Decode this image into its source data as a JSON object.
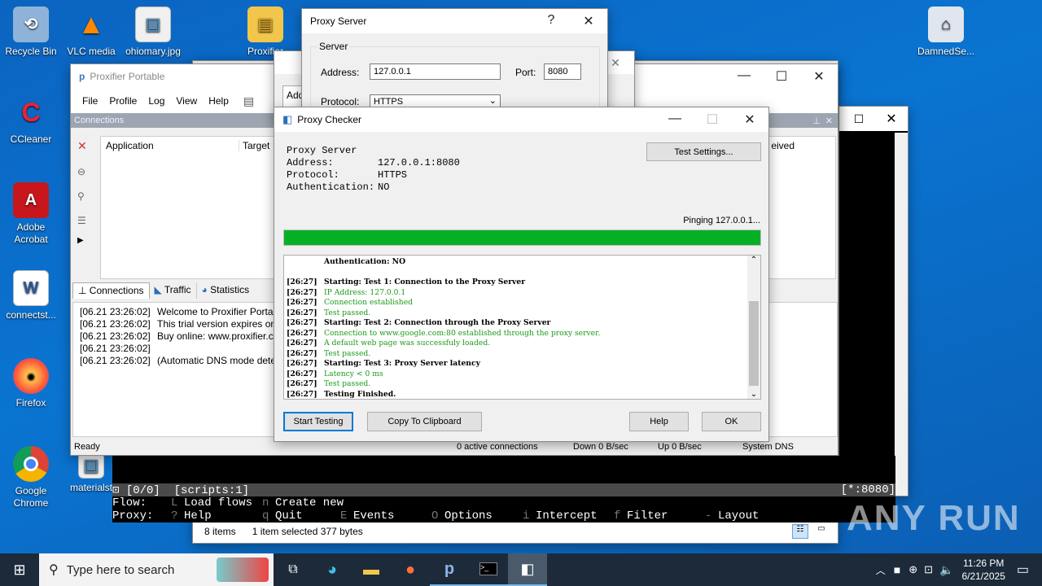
{
  "desktop": {
    "icons": [
      {
        "label": "Recycle Bin",
        "glyph": "🗑",
        "color": "#9ab"
      },
      {
        "label": "VLC media",
        "glyph": "▲",
        "color": "#f80"
      },
      {
        "label": "ohiomary.jpg",
        "glyph": "▣",
        "color": "#dde"
      },
      {
        "label": "Proxifier",
        "glyph": "▤",
        "color": "#eb3"
      },
      {
        "label": "DamnedSe...",
        "glyph": "⌂",
        "color": "#ccd"
      },
      {
        "label": "CCleaner",
        "glyph": "C",
        "color": "#d33"
      },
      {
        "label": "Adobe Acrobat",
        "glyph": "A",
        "color": "#c00"
      },
      {
        "label": "connectst...",
        "glyph": "W",
        "color": "#2b5"
      },
      {
        "label": "Firefox",
        "glyph": "●",
        "color": "#f60"
      },
      {
        "label": "Google Chrome",
        "glyph": "◉",
        "color": "#4a4"
      },
      {
        "label": "materialst",
        "glyph": "▣",
        "color": "#ddd"
      }
    ]
  },
  "proxifier": {
    "title": "Proxifier Portable",
    "menu": [
      "File",
      "Profile",
      "Log",
      "View",
      "Help"
    ],
    "connections_label": "Connections",
    "col_application": "Application",
    "col_target": "Target",
    "col_received": "eived",
    "tabs": [
      "Connections",
      "Traffic",
      "Statistics"
    ],
    "log": [
      {
        "time": "[06.21 23:26:02]",
        "text": "Welcome to Proxifier Porta"
      },
      {
        "time": "[06.21 23:26:02]",
        "text": "This trial version expires on"
      },
      {
        "time": "[06.21 23:26:02]",
        "text": "Buy online: www.proxifier.c"
      },
      {
        "time": "[06.21 23:26:02]",
        "text": ""
      },
      {
        "time": "[06.21 23:26:02]",
        "text": "(Automatic DNS mode detect"
      }
    ],
    "status": {
      "ready": "Ready",
      "active": "0 active connections",
      "down": "Down 0 B/sec",
      "up": "Up 0 B/sec",
      "dns": "System DNS"
    }
  },
  "proxy_server": {
    "title": "Proxy Server",
    "help": "?",
    "group": "Server",
    "address_label": "Address:",
    "address_value": "127.0.0.1",
    "port_label": "Port:",
    "port_value": "8080",
    "protocol_label": "Protocol:",
    "protocol_value": "HTTPS"
  },
  "behind_window": {
    "address_tab": "Add"
  },
  "checker": {
    "title": "Proxy Checker",
    "info": [
      {
        "k": "Proxy Server",
        "v": ""
      },
      {
        "k": "Address:",
        "v": "127.0.0.1:8080"
      },
      {
        "k": "Protocol:",
        "v": "HTTPS"
      },
      {
        "k": "Authentication:",
        "v": "NO"
      }
    ],
    "test_settings": "Test Settings...",
    "pinging": "Pinging 127.0.0.1...",
    "progress": 1.0,
    "log": [
      {
        "ts": "",
        "text": "Authentication: NO",
        "color": "#000",
        "bold": true
      },
      {
        "ts": "",
        "text": "",
        "color": "#000",
        "bold": false
      },
      {
        "ts": "[26:27]",
        "text": "Starting: Test 1: Connection to the Proxy Server",
        "color": "#000",
        "bold": true
      },
      {
        "ts": "[26:27]",
        "text": "IP Address: 127.0.0.1",
        "color": "#1a9a1a",
        "bold": false
      },
      {
        "ts": "[26:27]",
        "text": "Connection established",
        "color": "#1a9a1a",
        "bold": false
      },
      {
        "ts": "[26:27]",
        "text": "Test passed.",
        "color": "#1a9a1a",
        "bold": false
      },
      {
        "ts": "[26:27]",
        "text": "Starting: Test 2: Connection through the Proxy Server",
        "color": "#000",
        "bold": true
      },
      {
        "ts": "[26:27]",
        "text": "Connection to www.google.com:80 established through the proxy server.",
        "color": "#1a9a1a",
        "bold": false
      },
      {
        "ts": "[26:27]",
        "text": "A default web page was successfuly loaded.",
        "color": "#1a9a1a",
        "bold": false
      },
      {
        "ts": "[26:27]",
        "text": "Test passed.",
        "color": "#1a9a1a",
        "bold": false
      },
      {
        "ts": "[26:27]",
        "text": "Starting: Test 3: Proxy Server latency",
        "color": "#000",
        "bold": true
      },
      {
        "ts": "[26:27]",
        "text": "Latency < 0 ms",
        "color": "#1a9a1a",
        "bold": false
      },
      {
        "ts": "[26:27]",
        "text": "Test passed.",
        "color": "#1a9a1a",
        "bold": false
      },
      {
        "ts": "[26:27]",
        "text": "Testing Finished.",
        "color": "#000",
        "bold": true
      }
    ],
    "buttons": {
      "start": "Start Testing",
      "copy": "Copy To Clipboard",
      "help": "Help",
      "ok": "OK"
    }
  },
  "terminal": {
    "status_left": "⊡ [0/0]  [scripts:1]",
    "status_right": "[*:8080]",
    "row1_label": "Flow:",
    "row2_label": "Proxy:",
    "row1": [
      {
        "key": "L",
        "text": "Load flows"
      },
      {
        "key": "n",
        "text": "Create new"
      }
    ],
    "row2": [
      {
        "key": "?",
        "text": "Help"
      },
      {
        "key": "q",
        "text": "Quit"
      },
      {
        "key": "E",
        "text": "Events"
      },
      {
        "key": "O",
        "text": "Options"
      },
      {
        "key": "i",
        "text": "Intercept"
      },
      {
        "key": "f",
        "text": "Filter"
      },
      {
        "key": "-",
        "text": "Layout"
      }
    ]
  },
  "explorer_status": {
    "items": "8 items",
    "selected": "1 item selected  377 bytes"
  },
  "watermark": "ANY RUN",
  "taskbar": {
    "search_placeholder": "Type here to search",
    "time": "11:26 PM",
    "date": "6/21/2025"
  }
}
